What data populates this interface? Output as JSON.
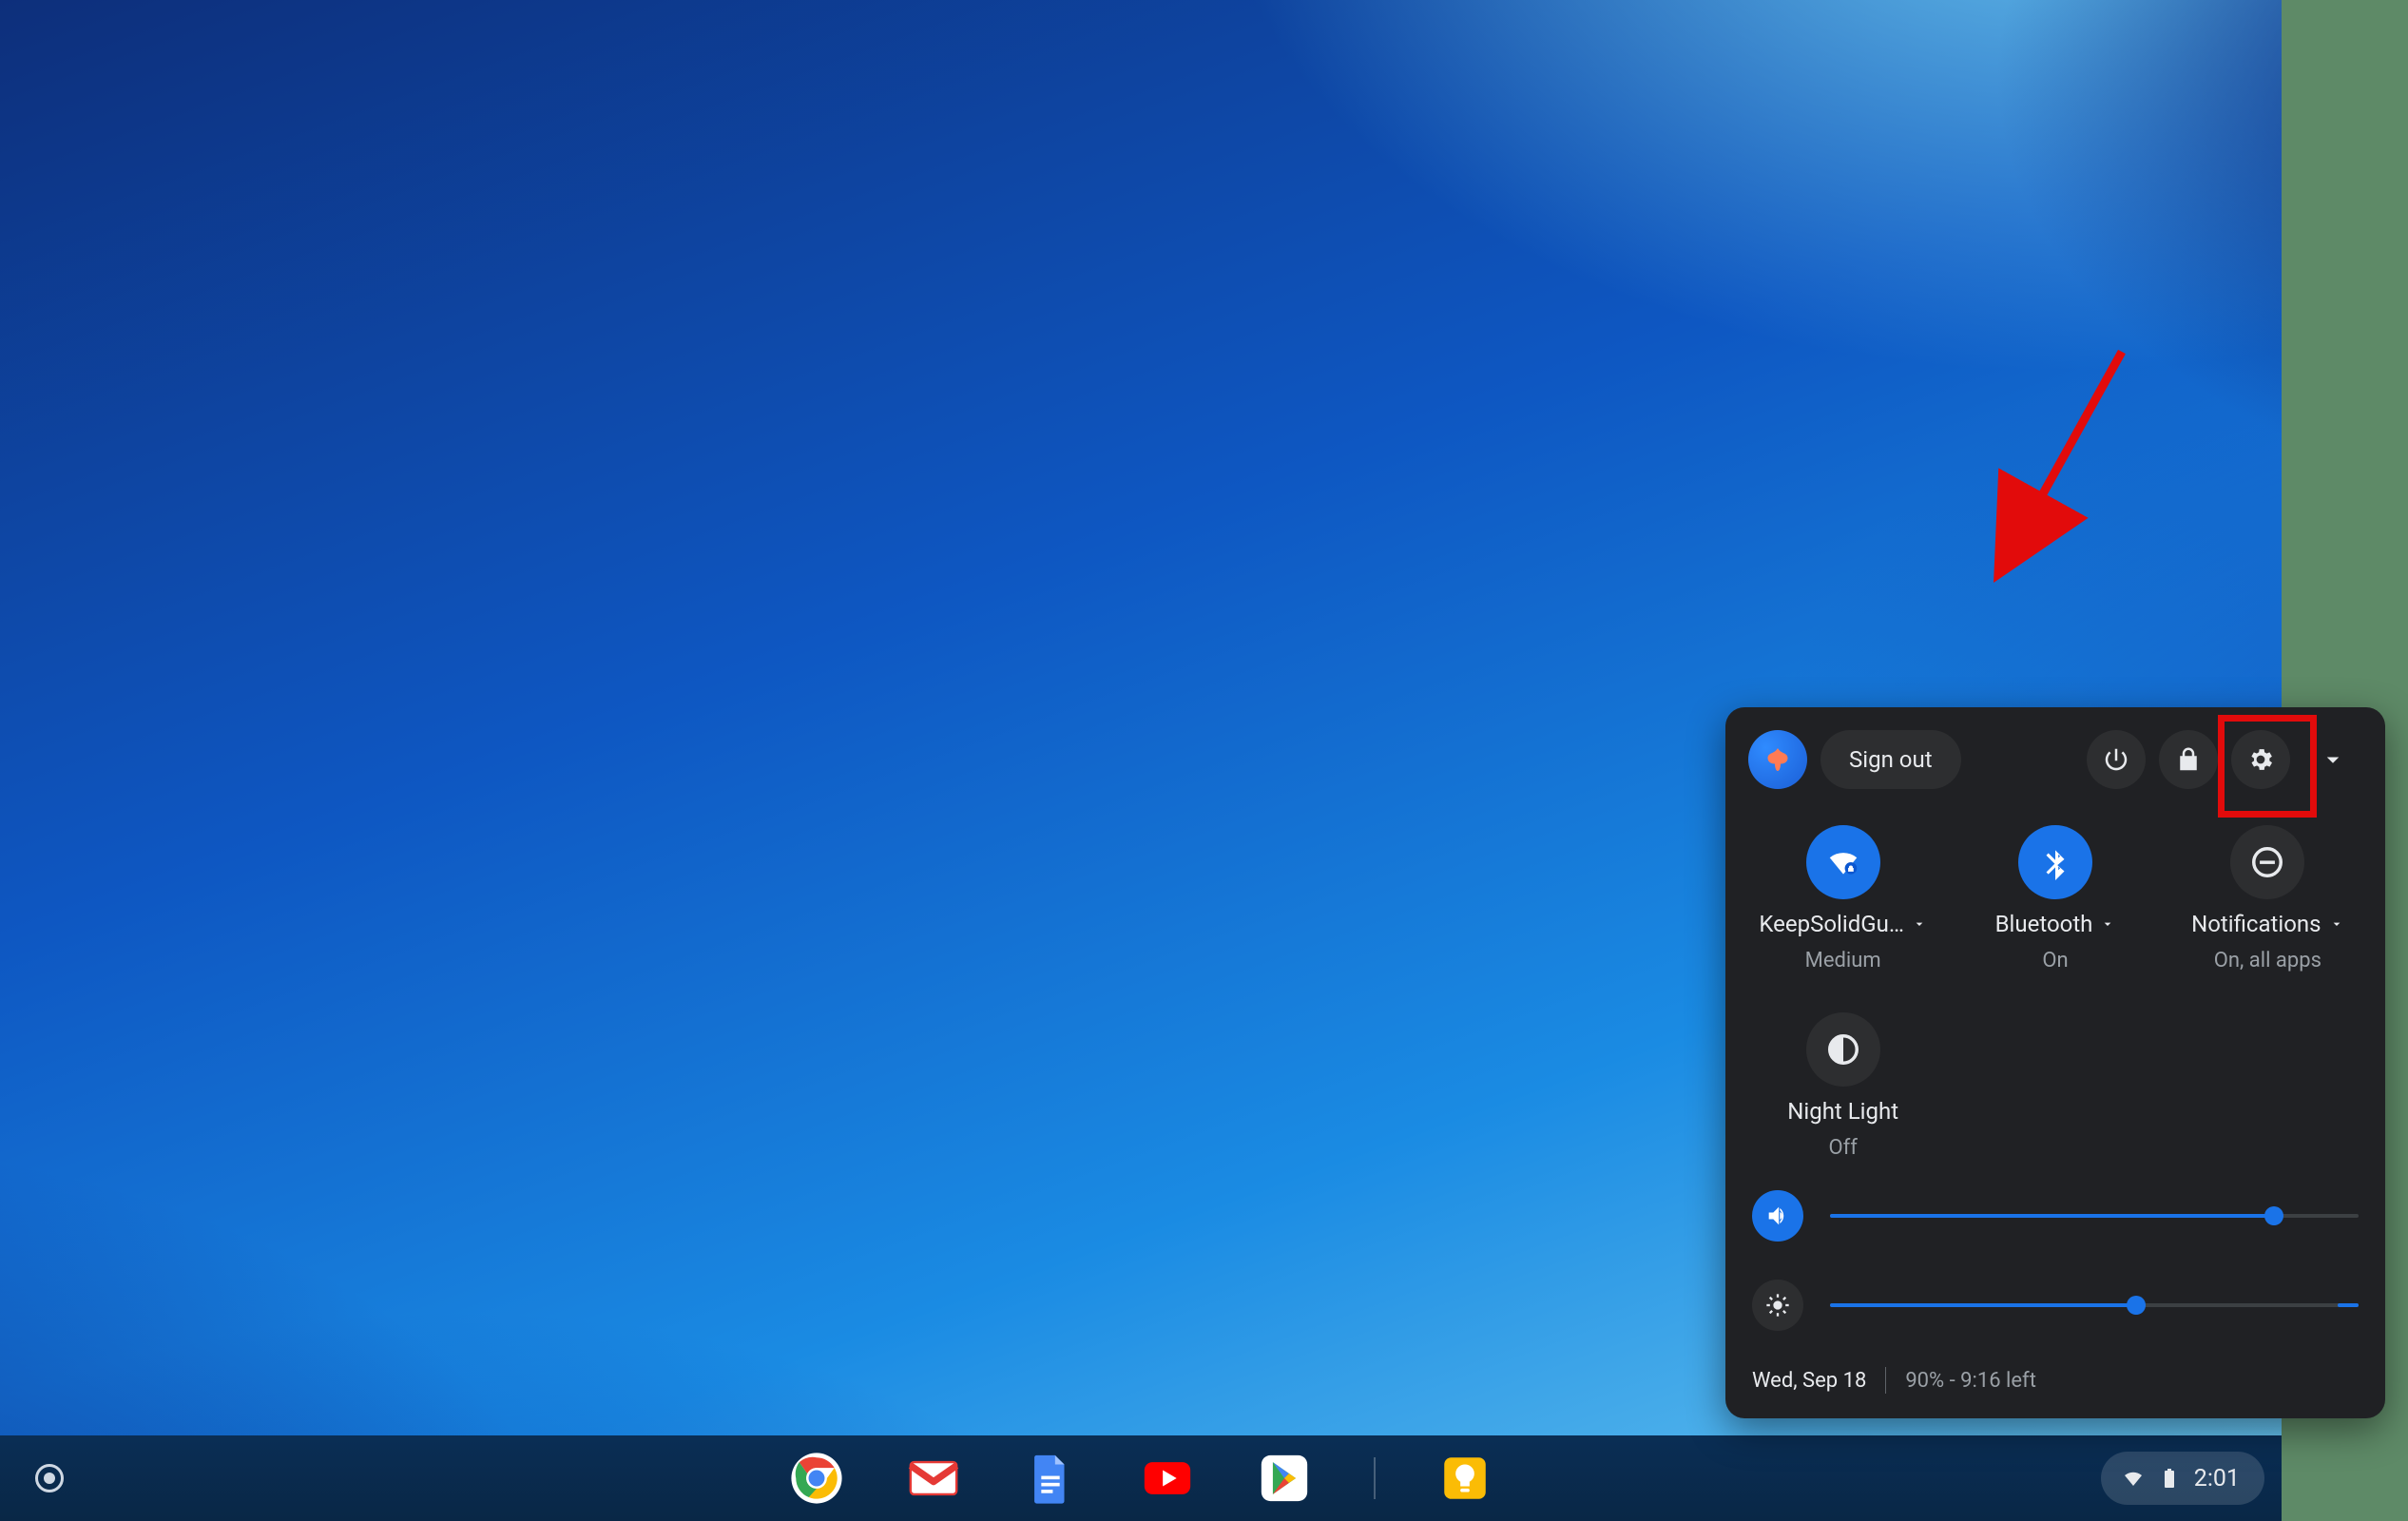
{
  "quick_settings": {
    "sign_out_label": "Sign out",
    "tiles": {
      "wifi": {
        "label": "KeepSolidGu…",
        "sub": "Medium"
      },
      "bluetooth": {
        "label": "Bluetooth",
        "sub": "On"
      },
      "notifications": {
        "label": "Notifications",
        "sub": "On, all apps"
      },
      "night_light": {
        "label": "Night Light",
        "sub": "Off"
      }
    },
    "sliders": {
      "volume_percent": 84,
      "brightness_percent": 58
    },
    "footer": {
      "date": "Wed, Sep 18",
      "battery": "90% - 9:16 left"
    }
  },
  "shelf": {
    "apps": [
      "Chrome",
      "Gmail",
      "Docs",
      "YouTube",
      "Play Store",
      "Keep"
    ]
  },
  "status_area": {
    "time": "2:01"
  },
  "annotation": {
    "target": "settings-button"
  }
}
